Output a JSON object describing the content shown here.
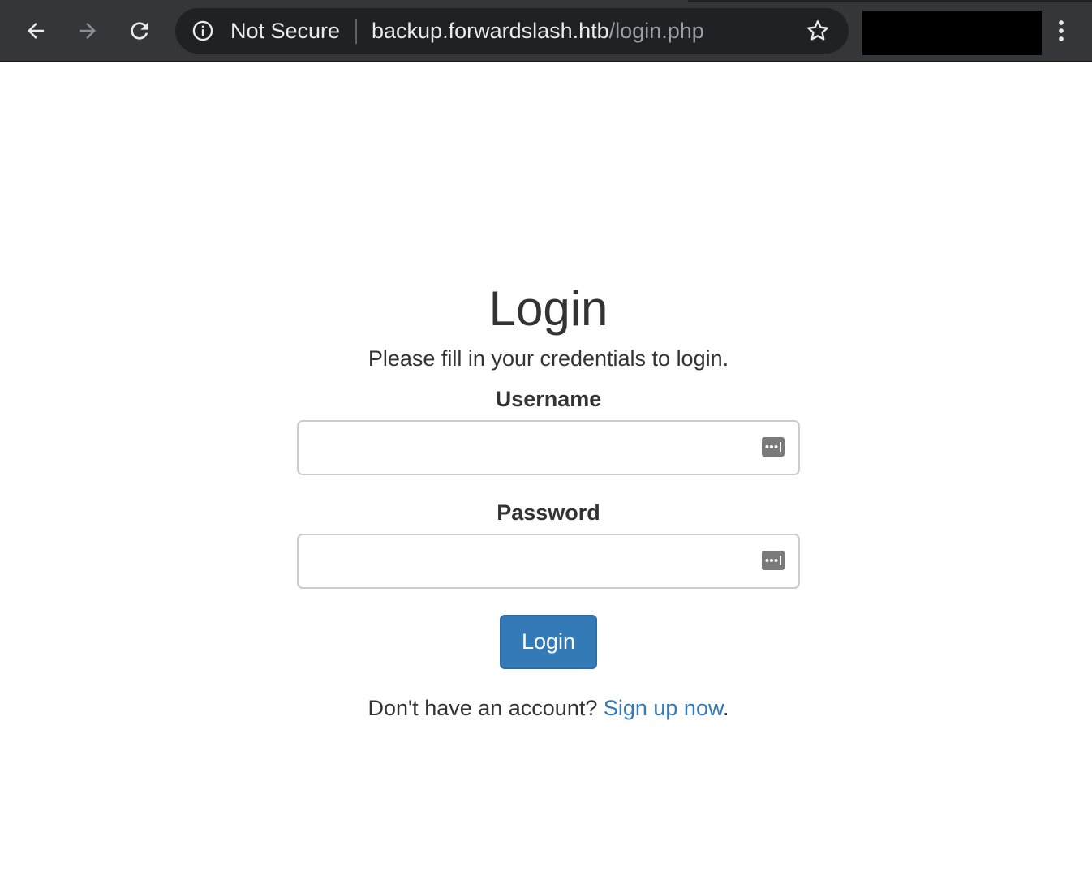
{
  "browser": {
    "security_label": "Not Secure",
    "url_host": "backup.forwardslash.htb",
    "url_path": "/login.php",
    "icons": {
      "back": "arrow-left-icon",
      "forward": "arrow-right-icon",
      "reload": "reload-icon",
      "info": "info-circle-icon",
      "bookmark": "star-icon",
      "menu": "three-dots-vertical-icon"
    },
    "colors": {
      "toolbar": "#35363a",
      "omnibox": "#202124",
      "text": "#e8eaed",
      "muted_text": "#9aa0a6"
    }
  },
  "login": {
    "title": "Login",
    "subtitle": "Please fill in your credentials to login.",
    "username_label": "Username",
    "username_value": "",
    "password_label": "Password",
    "password_value": "",
    "submit_label": "Login",
    "signup_prompt": "Don't have an account? ",
    "signup_link": "Sign up now",
    "signup_suffix": ".",
    "colors": {
      "primary": "#337ab7",
      "text": "#333333",
      "input_border": "#cccccc"
    }
  }
}
